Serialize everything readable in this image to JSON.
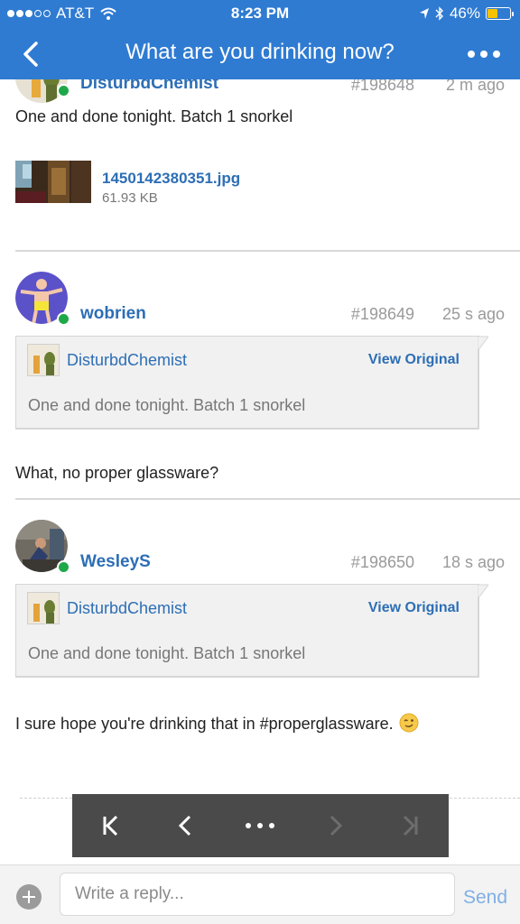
{
  "status_bar": {
    "carrier": "AT&T",
    "time": "8:23 PM",
    "battery": "46%",
    "battery_level": 0.46
  },
  "nav": {
    "title": "What are you drinking now?"
  },
  "posts": [
    {
      "username": "DisturbdChemist",
      "post_number": "#198648",
      "time_ago": "2 m ago",
      "text": "One and done tonight. Batch 1 snorkel",
      "attachment": {
        "filename": "1450142380351.jpg",
        "size": "61.93 KB"
      }
    },
    {
      "username": "wobrien",
      "post_number": "#198649",
      "time_ago": "25 s ago",
      "quote": {
        "author": "DisturbdChemist",
        "view_label": "View Original",
        "text": "One and done tonight. Batch 1 snorkel"
      },
      "text": "What, no proper glassware?"
    },
    {
      "username": "WesleyS",
      "post_number": "#198650",
      "time_ago": "18 s ago",
      "quote": {
        "author": "DisturbdChemist",
        "view_label": "View Original",
        "text": "One and done tonight. Batch 1 snorkel"
      },
      "text": "I sure hope you're drinking that in #properglassware."
    }
  ],
  "reply": {
    "placeholder": "Write a reply...",
    "send_label": "Send"
  }
}
